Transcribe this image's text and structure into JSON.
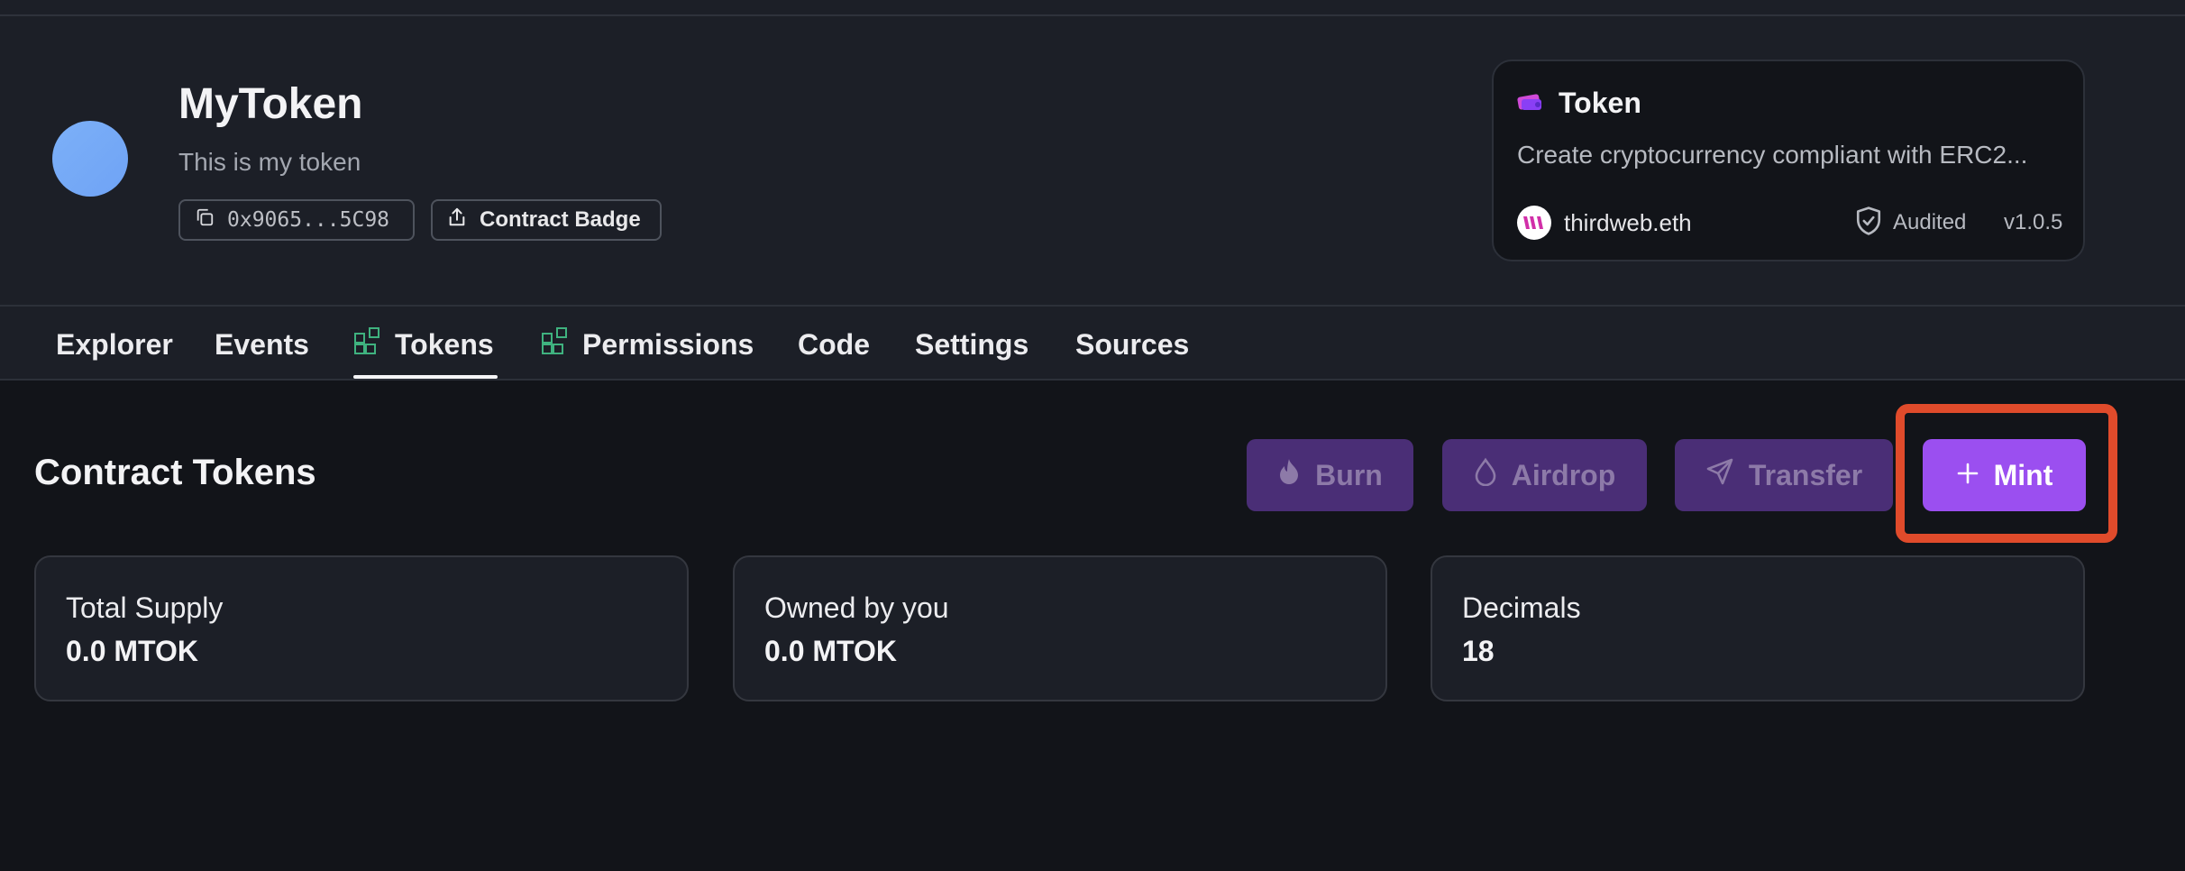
{
  "contract": {
    "name": "MyToken",
    "description": "This is my token",
    "address": "0x9065...5C98",
    "badge_label": "Contract Badge"
  },
  "template_card": {
    "title": "Token",
    "description": "Create cryptocurrency compliant with ERC2...",
    "author": "thirdweb.eth",
    "audited_label": "Audited",
    "version": "v1.0.5"
  },
  "tabs": [
    {
      "label": "Explorer",
      "active": false
    },
    {
      "label": "Events",
      "active": false
    },
    {
      "label": "Tokens",
      "active": true,
      "icon": "extension-icon"
    },
    {
      "label": "Permissions",
      "active": false,
      "icon": "extension-icon"
    },
    {
      "label": "Code",
      "active": false
    },
    {
      "label": "Settings",
      "active": false
    },
    {
      "label": "Sources",
      "active": false
    }
  ],
  "section": {
    "title": "Contract Tokens"
  },
  "actions": {
    "burn": "Burn",
    "airdrop": "Airdrop",
    "transfer": "Transfer",
    "mint": "Mint"
  },
  "stats": [
    {
      "label": "Total Supply",
      "value": "0.0 MTOK"
    },
    {
      "label": "Owned by you",
      "value": "0.0 MTOK"
    },
    {
      "label": "Decimals",
      "value": "18"
    }
  ],
  "colors": {
    "accent": "#9b4ff0",
    "highlight": "#e04b2b",
    "avatar": "#7cb0f8",
    "extension_icon": "#3fb27f"
  }
}
